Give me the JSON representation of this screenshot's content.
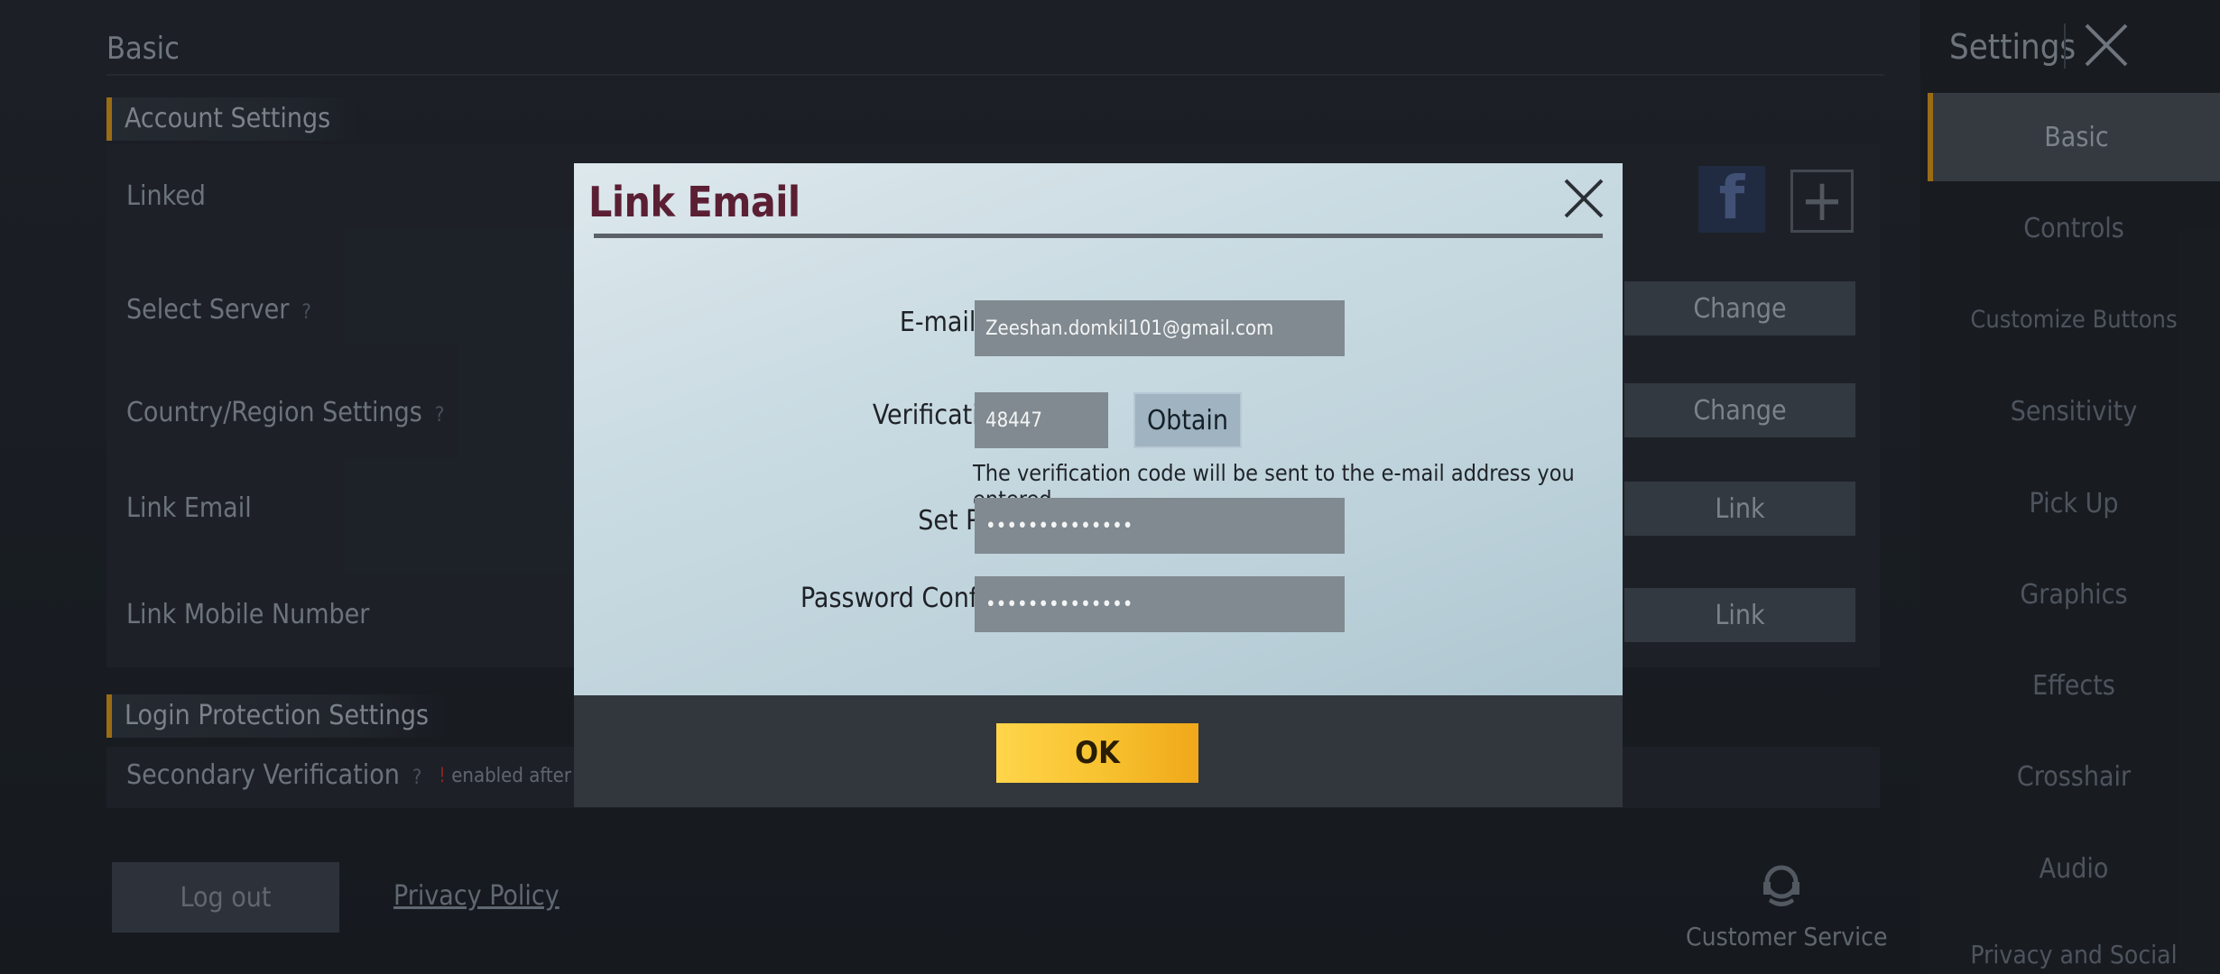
{
  "background": {
    "title": "Basic",
    "account_section": "Account Settings",
    "rows": [
      {
        "label": "Linked",
        "button": ""
      },
      {
        "label": "Select Server",
        "help": "?",
        "button": "Change"
      },
      {
        "label": "Country/Region Settings",
        "help": "?",
        "button": "Change"
      },
      {
        "label": "Link Email",
        "button": "Link"
      },
      {
        "label": "Link Mobile Number",
        "button": "Link"
      }
    ],
    "login_section": "Login Protection Settings",
    "secondary_verification": {
      "label": "Secondary Verification",
      "help": "?",
      "note": "enabled after"
    },
    "logout": "Log out",
    "privacy_policy": "Privacy Policy",
    "customer_service": "Customer Service",
    "icons": [
      "facebook-icon",
      "plus-icon",
      "headset-icon",
      "close-icon"
    ]
  },
  "sidebar": {
    "title": "Settings",
    "items": [
      {
        "label": "Basic",
        "active": true
      },
      {
        "label": "Controls"
      },
      {
        "label": "Customize Buttons"
      },
      {
        "label": "Sensitivity"
      },
      {
        "label": "Pick Up"
      },
      {
        "label": "Graphics"
      },
      {
        "label": "Effects"
      },
      {
        "label": "Crosshair"
      },
      {
        "label": "Audio"
      },
      {
        "label": "Privacy and Social"
      }
    ]
  },
  "modal": {
    "title": "Link Email",
    "email_label": "E-mail address",
    "email_value": "Zeeshan.domkil101@gmail.com",
    "code_label": "Verification Code",
    "code_value": "48447",
    "obtain": "Obtain",
    "hint": "The verification code will be sent to the e-mail address you entered.",
    "password_label": "Set Password",
    "password_value": "••••••••••••••",
    "confirm_label": "Password Confirmation",
    "confirm_value": "••••••••••••••",
    "ok": "OK"
  },
  "colors": {
    "accent": "#b07b19",
    "ok_button": "#f7c12e",
    "modal_title": "#5b1f34"
  }
}
